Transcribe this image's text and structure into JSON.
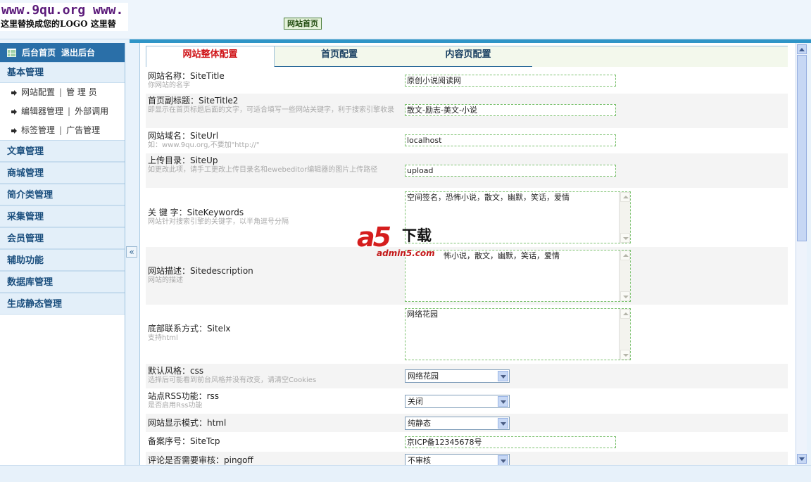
{
  "header": {
    "logo_site": "www.9qu.org www.",
    "logo_hint": "这里替换成您的LOGO  这里替",
    "home_button": "网站首页"
  },
  "sidebar": {
    "top_links": [
      "后台首页",
      "退出后台"
    ],
    "categories": [
      {
        "label": "基本管理",
        "subitems": [
          {
            "left": "网站配置",
            "right": "管 理 员"
          },
          {
            "left": "编辑器管理",
            "right": "外部调用"
          },
          {
            "left": "标签管理",
            "right": "广告管理"
          }
        ]
      },
      {
        "label": "文章管理"
      },
      {
        "label": "商城管理"
      },
      {
        "label": "简介类管理"
      },
      {
        "label": "采集管理"
      },
      {
        "label": "会员管理"
      },
      {
        "label": "辅助功能"
      },
      {
        "label": "数据库管理"
      },
      {
        "label": "生成静态管理"
      }
    ],
    "separator": "|",
    "collapse_glyph": "«"
  },
  "tabs": [
    "网站整体配置",
    "首页配置",
    "内容页配置"
  ],
  "active_tab": 0,
  "form": {
    "rows": [
      {
        "name": "网站名称：SiteTitle",
        "desc": "你网站的名字",
        "type": "text",
        "value": "原创小说阅读网"
      },
      {
        "name": "首页副标题：SiteTitle2",
        "desc": "即显示在首页标题后面的文字，可适合填写一些网站关键字，利于搜索引擎收录",
        "type": "text",
        "value": "散文-励志-美文-小说"
      },
      {
        "name": "网站域名：SiteUrl",
        "desc": "如：www.9qu.org,不要加\"http://\"",
        "type": "text",
        "value": "localhost"
      },
      {
        "name": "上传目录：SiteUp",
        "desc": "如更改此项，请手工更改上传目录名和ewebeditor编辑器的图片上传路径",
        "type": "text",
        "value": "upload"
      },
      {
        "name": "关 键 字：SiteKeywords",
        "desc": "网站针对搜索引擎的关键字，以半角逗号分隔",
        "type": "textarea",
        "value": "空间签名，恐怖小说，散文，幽默，笑话，爱情"
      },
      {
        "name": "网站描述：Sitedescription",
        "desc": "网站的描述",
        "type": "textarea",
        "value": "怖小说，散文，幽默，笑话，爱情"
      },
      {
        "name": "底部联系方式：Sitelx",
        "desc": "支持html",
        "type": "textarea",
        "value": "网络花园"
      },
      {
        "name": "默认风格：css",
        "desc": "选择后可能看到前台风格并没有改变，请清空Cookies",
        "type": "select",
        "value": "网络花园"
      },
      {
        "name": "站点RSS功能：rss",
        "desc": "是否启用Rss功能",
        "type": "select",
        "value": "关闭"
      },
      {
        "name": "网站显示模式：html",
        "desc": "",
        "type": "select",
        "value": "纯静态"
      },
      {
        "name": "备案序号：SiteTcp",
        "desc": "",
        "type": "text",
        "value": "京ICP备12345678号"
      },
      {
        "name": "评论是否需要审核：pingoff",
        "desc": "",
        "type": "select",
        "value": "不审核"
      }
    ]
  },
  "watermark": {
    "logo": "a5",
    "label": "下载",
    "domain": "admin5.com"
  },
  "colors": {
    "accent_red": "#d0161a",
    "sidebar_head": "#2a6fa8",
    "field_border": "#7cc16f",
    "strip_blue": "#2f95c7"
  }
}
